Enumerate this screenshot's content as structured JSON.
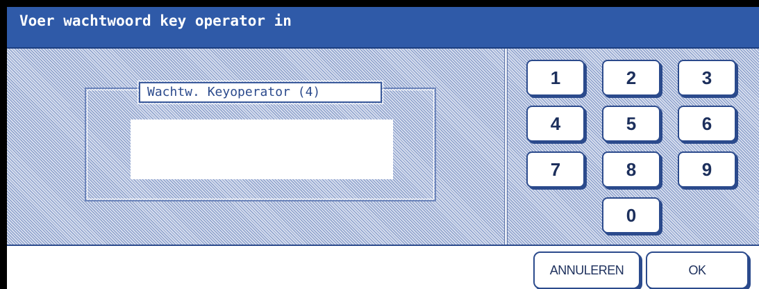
{
  "title": "Voer wachtwoord key operator in",
  "password": {
    "label": "Wachtw. Keyoperator (4)",
    "value": ""
  },
  "keypad": {
    "k1": "1",
    "k2": "2",
    "k3": "3",
    "k4": "4",
    "k5": "5",
    "k6": "6",
    "k7": "7",
    "k8": "8",
    "k9": "9",
    "k0": "0"
  },
  "buttons": {
    "cancel": "ANNULEREN",
    "ok": "OK"
  },
  "colors": {
    "title_bar": "#2f5aa8",
    "accent": "#2b4a8c"
  }
}
